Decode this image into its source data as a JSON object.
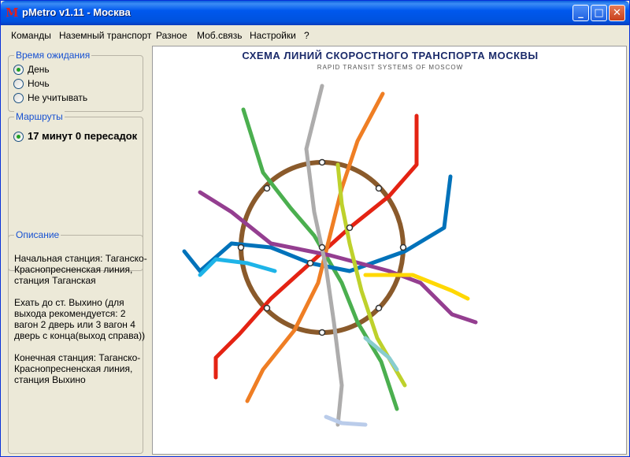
{
  "window": {
    "title": "pMetro v1.11 - Москва",
    "app_icon_glyph": "M",
    "controls": {
      "minimize": "_",
      "maximize": "□",
      "close": "✕"
    }
  },
  "menu": [
    "Команды",
    "Наземный транспорт",
    "Разное",
    "Моб.связь",
    "Настройки",
    "?"
  ],
  "wait_time": {
    "legend": "Время ожидания",
    "options": [
      {
        "label": "День",
        "selected": true
      },
      {
        "label": "Ночь",
        "selected": false
      },
      {
        "label": "Не учитывать",
        "selected": false
      }
    ]
  },
  "routes": {
    "legend": "Маршруты",
    "items": [
      {
        "label": "17 минут 0 пересадок",
        "selected": true
      }
    ]
  },
  "description": {
    "legend": "Описание",
    "paragraphs": [
      "Начальная станция: Таганско-Краснопресненская линия, станция Таганская",
      "Ехать до ст. Выхино (для выхода рекомендуется: 2 вагон 2 дверь или 3 вагон 4 дверь с конца(выход справа))",
      "Конечная станция: Таганско-Краснопресненская линия, станция Выхино"
    ]
  },
  "map": {
    "title": "СХЕМА ЛИНИЙ СКОРОСТНОГО ТРАНСПОРТА МОСКВЫ",
    "subtitle": "RAPID TRANSIT SYSTEMS OF MOSCOW",
    "line_colors": {
      "l1": "#e42313",
      "l2": "#4baf4f",
      "l3": "#0072ba",
      "l4": "#1eb4e8",
      "l5": "#8a5a2b",
      "l6": "#ef7e24",
      "l7": "#943e90",
      "l8": "#ffd803",
      "l9": "#adacac",
      "l10": "#bed12c",
      "l11": "#88cdcf",
      "l12": "#baccea"
    }
  }
}
